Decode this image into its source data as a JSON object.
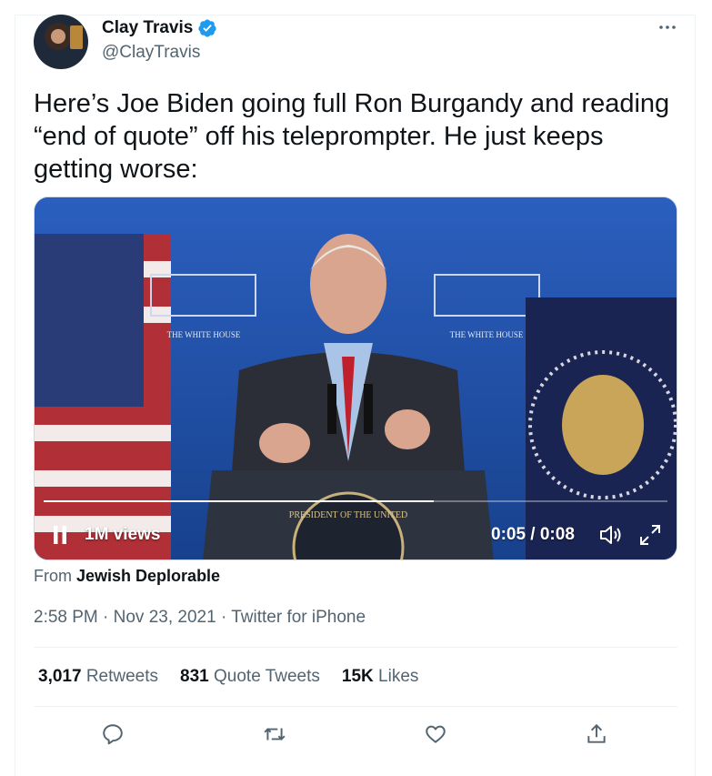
{
  "author": {
    "name": "Clay Travis",
    "handle": "@ClayTravis"
  },
  "icons": [
    "verified-badge-icon",
    "more-icon",
    "pause-icon",
    "volume-icon",
    "fullscreen-icon",
    "reply-icon",
    "retweet-icon",
    "like-icon",
    "share-icon"
  ],
  "tweet": {
    "text": "Here’s Joe Biden going full Ron Burgandy and reading “end of quote” off his teleprompter. He just keeps getting worse:"
  },
  "video": {
    "views": "1M views",
    "time": "0:05 / 0:08",
    "progress_fraction": 0.625,
    "podium_seal_text": "PRESIDENT OF THE UNITED",
    "backdrop_text_left": "THE WHITE HOUSE",
    "backdrop_text_right": "THE WHITE HOUSE"
  },
  "source": {
    "prefix": "From",
    "name": "Jewish Deplorable"
  },
  "meta": {
    "timestamp": "2:58 PM · Nov 23, 2021 · Twitter for iPhone"
  },
  "stats": {
    "retweets_count": "3,017",
    "retweets_label": "Retweets",
    "quotes_count": "831",
    "quotes_label": "Quote Tweets",
    "likes_count": "15K",
    "likes_label": "Likes"
  },
  "colors": {
    "verified_blue": "#1d9bf0",
    "secondary_text": "#536471",
    "primary_text": "#0f1419",
    "divider": "#eff3f4"
  }
}
